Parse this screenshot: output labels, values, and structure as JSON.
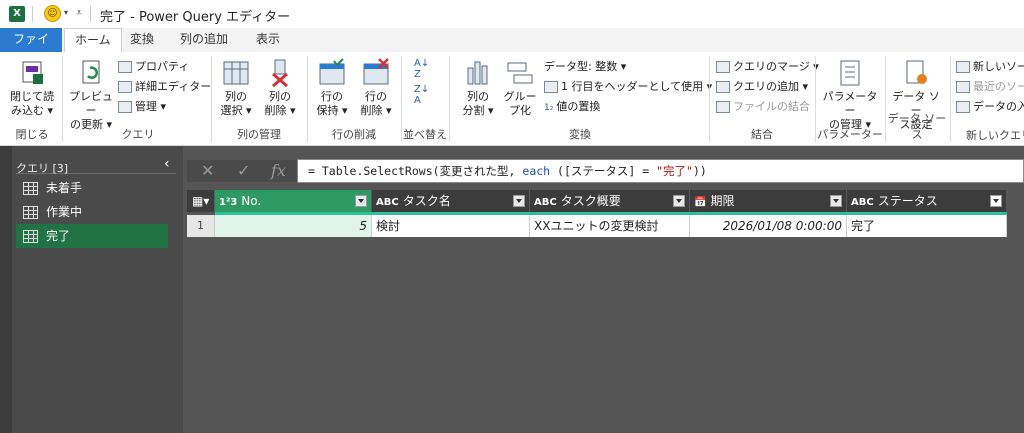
{
  "window": {
    "title": "完了 - Power Query エディター",
    "app_icon": "excel-icon"
  },
  "tabs": [
    "ファイル",
    "ホーム",
    "変換",
    "列の追加",
    "表示"
  ],
  "ribbon": {
    "close_load": {
      "label1": "閉じて読",
      "label2": "み込む ▾",
      "group": "閉じる"
    },
    "preview": {
      "label1": "プレビュー",
      "label2": "の更新 ▾"
    },
    "properties": "プロパティ",
    "advanced_editor": "詳細エディター",
    "manage": "管理 ▾",
    "query_group": "クエリ",
    "choose_cols": {
      "label1": "列の",
      "label2": "選択 ▾"
    },
    "remove_cols": {
      "label1": "列の",
      "label2": "削除 ▾"
    },
    "manage_cols_group": "列の管理",
    "keep_rows": {
      "label1": "行の",
      "label2": "保持 ▾"
    },
    "remove_rows": {
      "label1": "行の",
      "label2": "削除 ▾"
    },
    "reduce_rows_group": "行の削減",
    "sort_group": "並べ替え",
    "split_col": {
      "label1": "列の",
      "label2": "分割 ▾"
    },
    "group_by": {
      "label1": "グルー",
      "label2": "プ化"
    },
    "data_type": "データ型: 整数 ▾",
    "first_row_header": "1 行目をヘッダーとして使用 ▾",
    "replace_values": "値の置換",
    "transform_group": "変換",
    "merge_queries": "クエリのマージ ▾",
    "append_queries": "クエリの追加 ▾",
    "combine_files": "ファイルの結合",
    "combine_group": "結合",
    "params": {
      "label1": "パラメーター",
      "label2": "の管理 ▾"
    },
    "params_group": "パラメーター",
    "data_source": {
      "label1": "データ ソー",
      "label2": "ス設定"
    },
    "data_source_group": "データ ソース",
    "new_source": "新しいソース",
    "recent_source": "最近のソース",
    "enter_data": "データの入力",
    "new_query_group": "新しいクエリ"
  },
  "queries": {
    "header": "クエリ [3]",
    "items": [
      "未着手",
      "作業中",
      "完了"
    ],
    "selected": "完了"
  },
  "formula": {
    "prefix": "= Table.SelectRows(変更された型, ",
    "kw": "each",
    "mid": " ([ステータス] = ",
    "str": "\"完了\"",
    "suffix": "))"
  },
  "table": {
    "columns": [
      {
        "type": "1²3",
        "name": "No."
      },
      {
        "type": "ABC",
        "name": "タスク名"
      },
      {
        "type": "ABC",
        "name": "タスク概要"
      },
      {
        "type": "📅",
        "name": "期限"
      },
      {
        "type": "ABC",
        "name": "ステータス"
      }
    ],
    "rows": [
      {
        "row_no": "1",
        "no": "5",
        "task": "検討",
        "summary": "XXユニットの変更検討",
        "due": "2026/01/08 0:00:00",
        "status": "完了"
      }
    ]
  }
}
